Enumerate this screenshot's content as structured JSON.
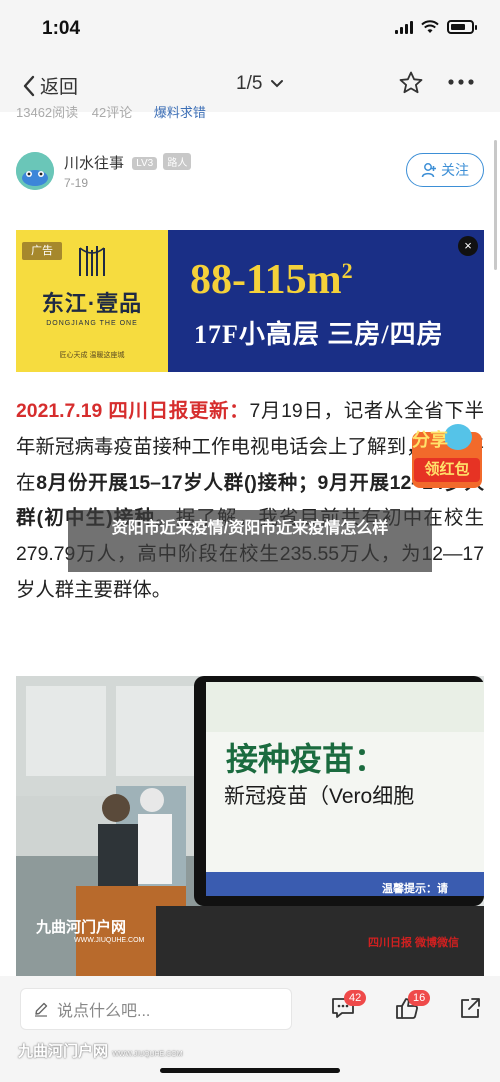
{
  "status_bar": {
    "time": "1:04"
  },
  "nav": {
    "back_label": "返回",
    "pager": "1/5"
  },
  "meta_line": {
    "views": "13462阅读",
    "comments": "42评论",
    "hot": "爆料求错"
  },
  "author": {
    "name": "川水往事",
    "level_badge": "LV3",
    "role_badge": "路人",
    "date": "7-19",
    "follow_label": "关注"
  },
  "ad": {
    "tag": "广告",
    "brand": "东江·壹品",
    "brand_en": "DONGJIANG THE ONE",
    "slogan": "匠心天成 温暖这座城",
    "area_prefix": "88-115m",
    "area_sup": "2",
    "type": "17F小高层 三房/四房",
    "close": "×"
  },
  "article": {
    "headline": "2021.7.19 四川日报更新：",
    "p1": "7月19日，记者从全省下半年新冠病毒疫苗接种工作电视电话会上了解到，全省将在",
    "bold1": "8月份开展15–17岁人群(",
    "p1b": "",
    "bold2": ")接种；9月开展12–14岁人群(初中生)接种",
    "p2": "。据了解，我省目前共有初中在校生279.79万人，高中阶段在校生235.55万人，为12—17岁人群主要群体。"
  },
  "overlay_title": "资阳市近来疫情/资阳市近来疫情怎么样",
  "red_packet": {
    "top": "分享",
    "bottom": "领红包"
  },
  "photo": {
    "screen_title": "接种疫苗：",
    "screen_sub": "新冠疫苗（Vero细胞",
    "screen_hint": "温馨提示：请",
    "watermark": "九曲河门户网",
    "watermark_url": "WWW.JIUQUHE.COM",
    "watermark_right": "四川日报 微博微信"
  },
  "bottom_bar": {
    "comment_placeholder": "说点什么吧...",
    "comment_count": "42",
    "like_count": "16",
    "watermark": "九曲河门户网",
    "watermark_url": "WWW.JIUQUHE.COM"
  },
  "colors": {
    "accent_blue": "#3d8fd6",
    "headline_red": "#d62d2d",
    "badge_red": "#ef4a4a",
    "ad_yellow": "#f6dc3f",
    "ad_blue": "#1a2f86"
  }
}
